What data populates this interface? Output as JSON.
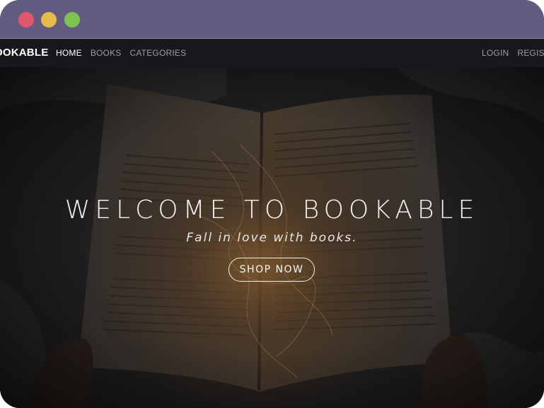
{
  "brand": "OOKABLE",
  "nav": {
    "left": [
      {
        "label": "HOME",
        "active": true
      },
      {
        "label": "BOOKS",
        "active": false
      },
      {
        "label": "CATEGORIES",
        "active": false
      }
    ],
    "right": [
      {
        "label": "LOGIN"
      },
      {
        "label": "REGISTE"
      }
    ]
  },
  "hero": {
    "title": "WELCOME TO BOOKABLE",
    "subtitle": "Fall in love with books.",
    "button": "SHOP NOW",
    "image": "open-book-with-fairy-lights"
  },
  "colors": {
    "titlebar": "#635c80",
    "navbar": "#17181b",
    "traffic_red": "#e0566a",
    "traffic_yellow": "#e5bb4e",
    "traffic_green": "#7cc251"
  }
}
